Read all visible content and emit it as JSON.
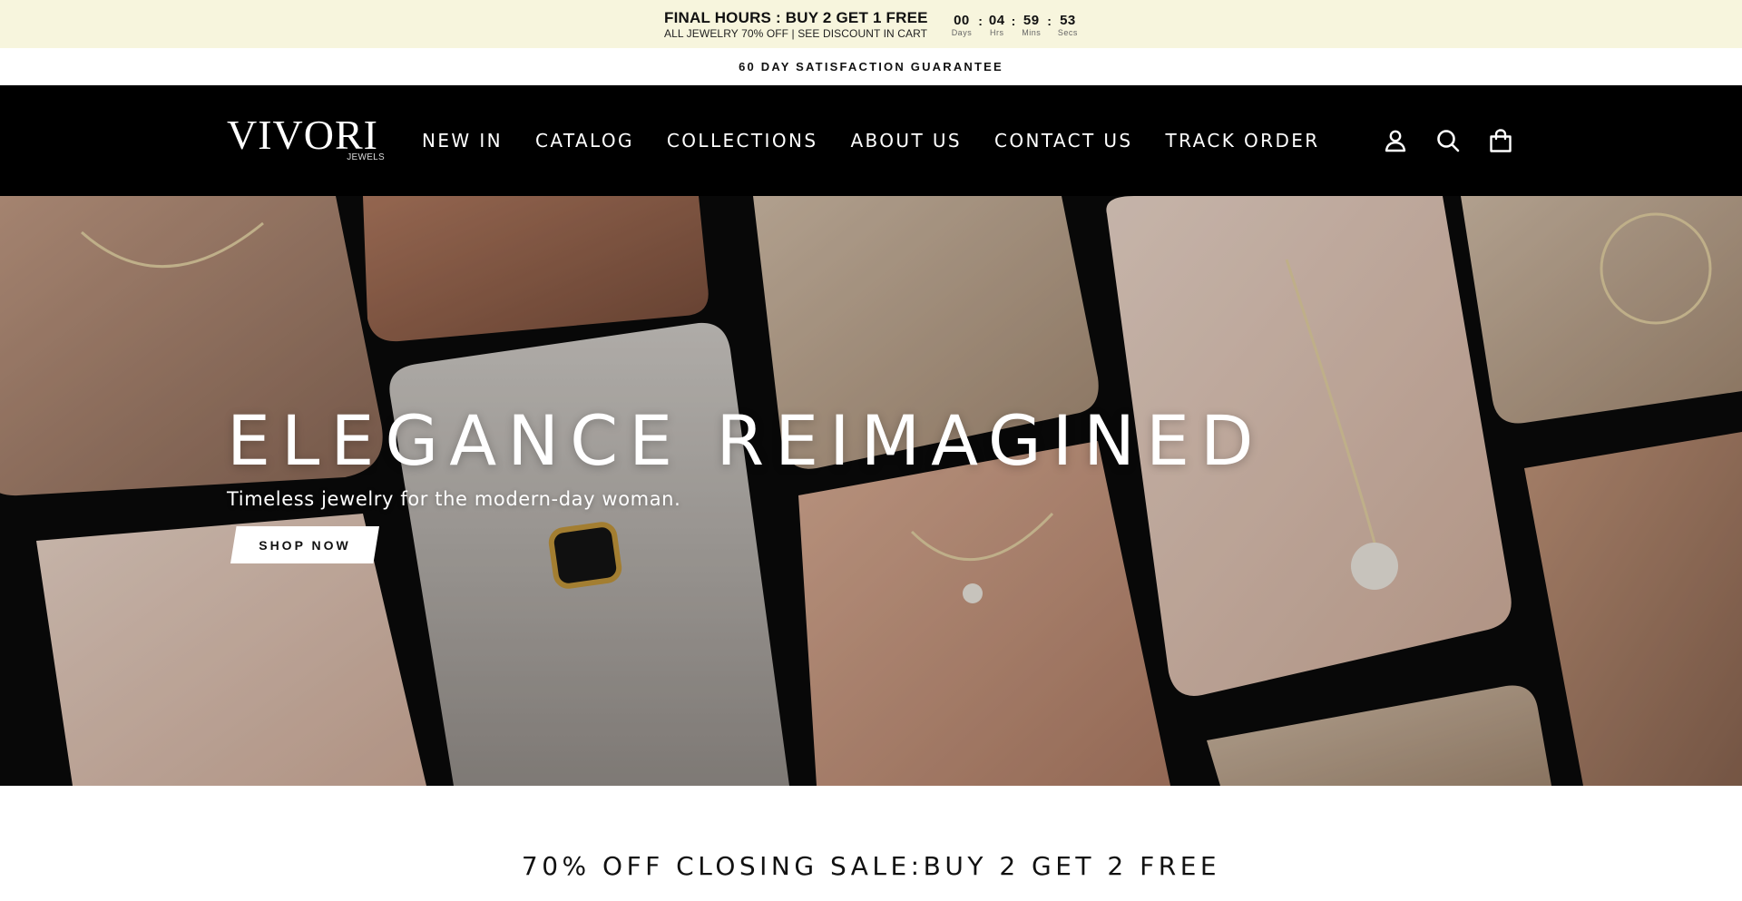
{
  "promo": {
    "headline": "FINAL HOURS : BUY 2 GET 1 FREE",
    "subtext": "ALL JEWELRY 70% OFF | SEE DISCOUNT IN CART",
    "countdown": {
      "days": "00",
      "hours": "04",
      "mins": "59",
      "secs": "53",
      "days_label": "Days",
      "hours_label": "Hrs",
      "mins_label": "Mins",
      "secs_label": "Secs",
      "separator": ":"
    },
    "background_color": "#f7f5dd"
  },
  "guarantee": {
    "text": "60 DAY SATISFACTION GUARANTEE"
  },
  "header": {
    "logo": {
      "main": "VIVORI",
      "sub": "JEWELS"
    },
    "nav": [
      {
        "label": "NEW IN"
      },
      {
        "label": "CATALOG"
      },
      {
        "label": "COLLECTIONS"
      },
      {
        "label": "ABOUT US"
      },
      {
        "label": "CONTACT US"
      },
      {
        "label": "TRACK ORDER"
      }
    ],
    "icons": [
      "account-icon",
      "search-icon",
      "cart-icon"
    ],
    "background_color": "#000000"
  },
  "hero": {
    "title": "ELEGANCE REIMAGINED",
    "subtitle": "Timeless jewelry for the modern-day woman.",
    "button_label": "SHOP NOW"
  },
  "sale": {
    "heading": "70% OFF CLOSING SALE:BUY 2 GET 2 FREE"
  }
}
